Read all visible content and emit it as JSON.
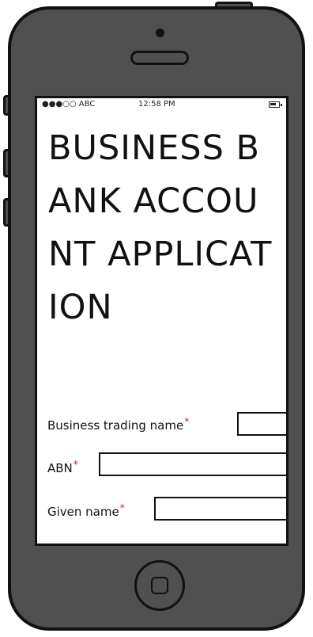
{
  "status_bar": {
    "carrier": "●●●○○ ABC",
    "time": "12:58 PM",
    "battery_icon": "battery-icon"
  },
  "page": {
    "title": "BUSINESS BANK ACCOUNT APPLICATION"
  },
  "form": {
    "fields": [
      {
        "label": "Business trading name",
        "required_mark": "*",
        "value": ""
      },
      {
        "label": "ABN",
        "required_mark": "*",
        "value": ""
      },
      {
        "label": "Given name",
        "required_mark": "*",
        "value": ""
      }
    ]
  },
  "colors": {
    "device_body": "#505050",
    "outline": "#111111",
    "screen": "#ffffff",
    "required": "#d12020"
  }
}
